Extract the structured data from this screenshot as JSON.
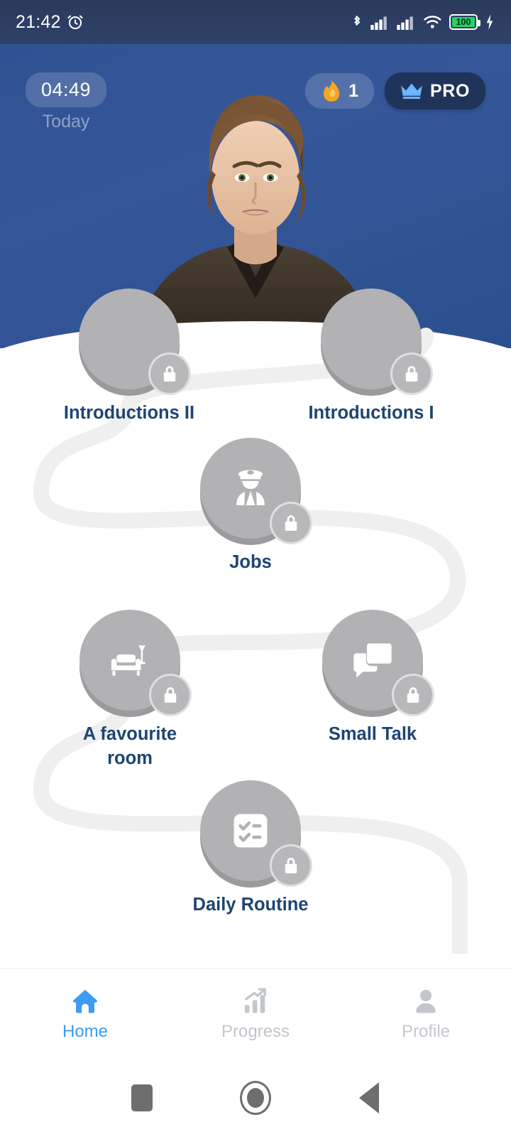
{
  "status_bar": {
    "time": "21:42",
    "alarm_icon": "alarm-icon",
    "bluetooth_icon": "bluetooth-icon",
    "signal_icon_1": "signal-bars-icon",
    "signal_icon_2": "signal-bars-icon",
    "wifi_icon": "wifi-icon",
    "battery_level": "100",
    "charging_icon": "charging-bolt-icon"
  },
  "header": {
    "timer_value": "04:49",
    "timer_sublabel": "Today",
    "streak_icon": "fire-icon",
    "streak_count": "1",
    "pro_icon": "crown-icon",
    "pro_label": "PRO",
    "avatar_alt": "tutor-portrait",
    "bg_color": "#2f5293",
    "pro_bg_color": "#203459"
  },
  "lesson_path": {
    "node_color": "#b2b2b4",
    "label_color": "#1e4572",
    "nodes": [
      {
        "id": "introductions-2",
        "label": "Introductions II",
        "icon": "partially-hidden-icon",
        "locked": true
      },
      {
        "id": "introductions-1",
        "label": "Introductions I",
        "icon": "partially-hidden-icon",
        "locked": true
      },
      {
        "id": "jobs",
        "label": "Jobs",
        "icon": "pilot-officer-icon",
        "locked": true
      },
      {
        "id": "a-favourite-room",
        "label": "A favourite room",
        "icon": "sofa-lamp-icon",
        "locked": true
      },
      {
        "id": "small-talk",
        "label": "Small Talk",
        "icon": "chat-bubbles-icon",
        "locked": true
      },
      {
        "id": "daily-routine",
        "label": "Daily Routine",
        "icon": "checklist-icon",
        "locked": true
      }
    ]
  },
  "bottom_nav": {
    "active_color": "#3b9bf5",
    "inactive_color": "#c3c6cb",
    "items": [
      {
        "id": "home",
        "label": "Home",
        "icon": "home-icon",
        "active": true
      },
      {
        "id": "progress",
        "label": "Progress",
        "icon": "bar-chart-icon",
        "active": false
      },
      {
        "id": "profile",
        "label": "Profile",
        "icon": "person-icon",
        "active": false
      }
    ]
  },
  "android_nav": {
    "recents_icon": "square-recents-icon",
    "home_icon": "circle-home-icon",
    "back_icon": "triangle-back-icon"
  }
}
